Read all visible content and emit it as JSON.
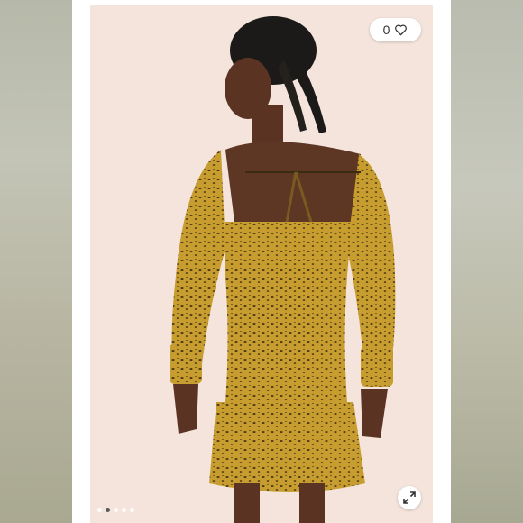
{
  "like": {
    "count": "0",
    "icon": "heart-outline-icon"
  },
  "carousel": {
    "total_images": 5,
    "active_index": 1
  },
  "expand": {
    "icon": "expand-arrows-icon"
  },
  "colors": {
    "background": "#f4e4dc",
    "dress": "#c9a032",
    "print": "#3a2a10"
  }
}
